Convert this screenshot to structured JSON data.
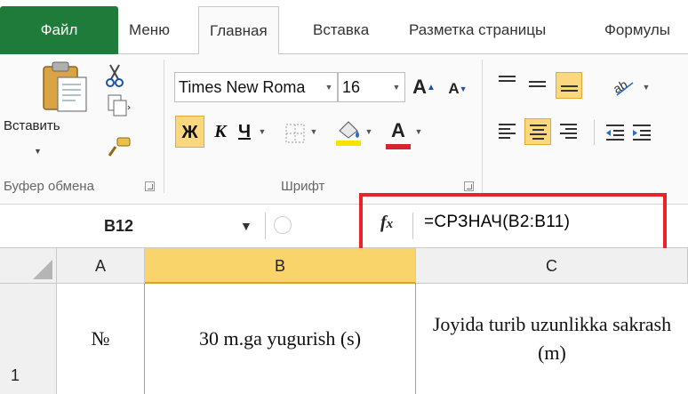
{
  "tabs": {
    "file": "Файл",
    "items": [
      "Меню",
      "Главная",
      "Вставка",
      "Разметка страницы",
      "Формулы"
    ],
    "active": "Главная"
  },
  "ribbon": {
    "clipboard": {
      "paste_label": "Вставить",
      "group_label": "Буфер обмена"
    },
    "font": {
      "font_name": "Times New Roma",
      "font_size": "16",
      "bold": "Ж",
      "italic": "К",
      "underline": "Ч",
      "group_label": "Шрифт",
      "highlight_color": "#f7e200",
      "font_color": "#d8232a"
    }
  },
  "formula_bar": {
    "name_box": "B12",
    "fx": "fx",
    "formula": "=СРЗНАЧ(B2:B11)"
  },
  "sheet": {
    "columns": [
      "A",
      "B",
      "C"
    ],
    "selected_column": "B",
    "rows": [
      {
        "number": "1",
        "cells": [
          "№",
          "30 m.ga yugurish (s)",
          "Joyida turib uzunlikka sakrash (m)"
        ]
      }
    ]
  },
  "colors": {
    "file_tab": "#1e7b3a",
    "selected_button": "#fbd87e",
    "highlight_box": "#e8242a"
  }
}
